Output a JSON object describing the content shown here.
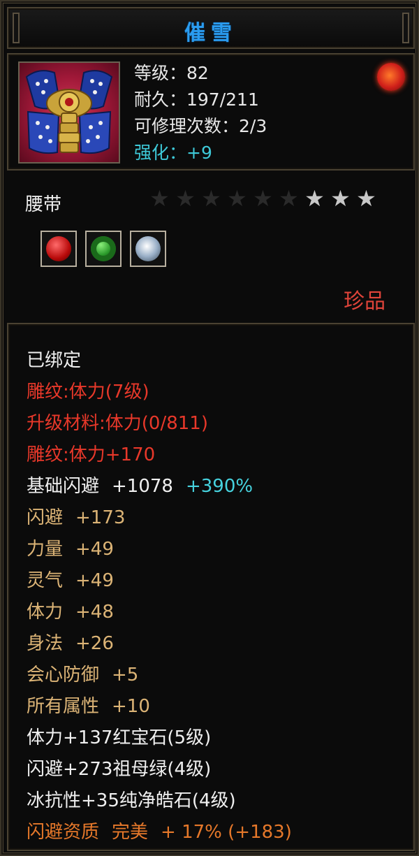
{
  "item": {
    "name": "催雪",
    "level": "等级：82",
    "durability": "耐久：197/211",
    "repair": "可修理次数：2/3",
    "enhance": "强化：+9",
    "type": "腰带",
    "stars_total": 9,
    "stars_lit": 3,
    "rarity": "珍品",
    "sockets": [
      "red-gem-icon",
      "green-gem-icon",
      "white-gem-icon"
    ]
  },
  "attributes": {
    "bound": "已绑定",
    "engrave": "雕纹:体力(7级)",
    "upgrade": "升级材料:体力(0/811)",
    "engrave_bonus": "雕纹:体力+170",
    "base_dodge_label": "基础闪避",
    "base_dodge_value": "+1078",
    "base_dodge_pct": "+390%",
    "stats": [
      {
        "label": "闪避",
        "value": "+173"
      },
      {
        "label": "力量",
        "value": "+49"
      },
      {
        "label": "灵气",
        "value": "+49"
      },
      {
        "label": "体力",
        "value": "+48"
      },
      {
        "label": "身法",
        "value": "+26"
      },
      {
        "label": "会心防御",
        "value": "+5"
      },
      {
        "label": "所有属性",
        "value": "+10"
      }
    ],
    "gems": [
      "体力+137红宝石(5级)",
      "闪避+273祖母绿(4级)",
      "冰抗性+35纯净皓石(4级)"
    ],
    "aptitude_label": "闪避资质",
    "aptitude_grade": "完美",
    "aptitude_value": "+ 17% (+183)"
  },
  "colors": {
    "title": "#2a9cf0",
    "red_text": "#e8382a",
    "gold_text": "#dcb476",
    "cyan_text": "#46d2de",
    "orange_text": "#e6782a"
  }
}
